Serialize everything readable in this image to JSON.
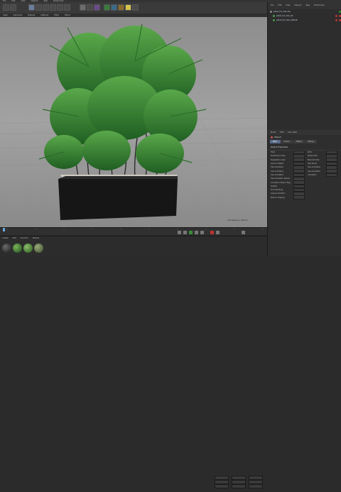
{
  "menubar": [
    "File",
    "Edit",
    "View",
    "Objects",
    "Tags",
    "Bookmarks"
  ],
  "viewport": {
    "menu": [
      "View",
      "Cameras",
      "Display",
      "Options",
      "Filter",
      "Panel"
    ],
    "label": "Perspective",
    "status": "Grid Spacing : 100 cm"
  },
  "object_manager": {
    "menu": [
      "File",
      "Edit",
      "View",
      "Objects",
      "Tags",
      "Bookmarks"
    ],
    "items": [
      {
        "name": "plant_hd_max.obj"
      },
      {
        "name": "plant_hd_max_01"
      },
      {
        "name": "plant_hd_max_default"
      }
    ]
  },
  "attributes": {
    "menu": [
      "Mode",
      "Edit",
      "User Data"
    ],
    "title": "Object",
    "tabs": [
      "Basic",
      "Coord.",
      "Object",
      "Phong"
    ],
    "section": "Object Properties",
    "left_rows": [
      "Fillet",
      "Subdivision Size",
      "Tessellation Size",
      "Level of Detail",
      "Use Animation",
      "Use Animation",
      "Use Animation",
      "Use Animation Speed",
      "Animation Object Type",
      "Quality",
      "Time Shading",
      "Leaves Variation",
      "Branch Clipping"
    ],
    "right_rows": [
      "Wind",
      "Shape Size",
      "Maximal Size",
      "Size Roots",
      "Use Animation",
      "Use Animation",
      "Animation"
    ]
  },
  "materials": {
    "menu": [
      "Create",
      "Edit",
      "Function",
      "Texture"
    ],
    "count": 4
  },
  "colors": {
    "accent": "#5a6a8a",
    "green": "#2f8a2f",
    "red": "#b33"
  }
}
